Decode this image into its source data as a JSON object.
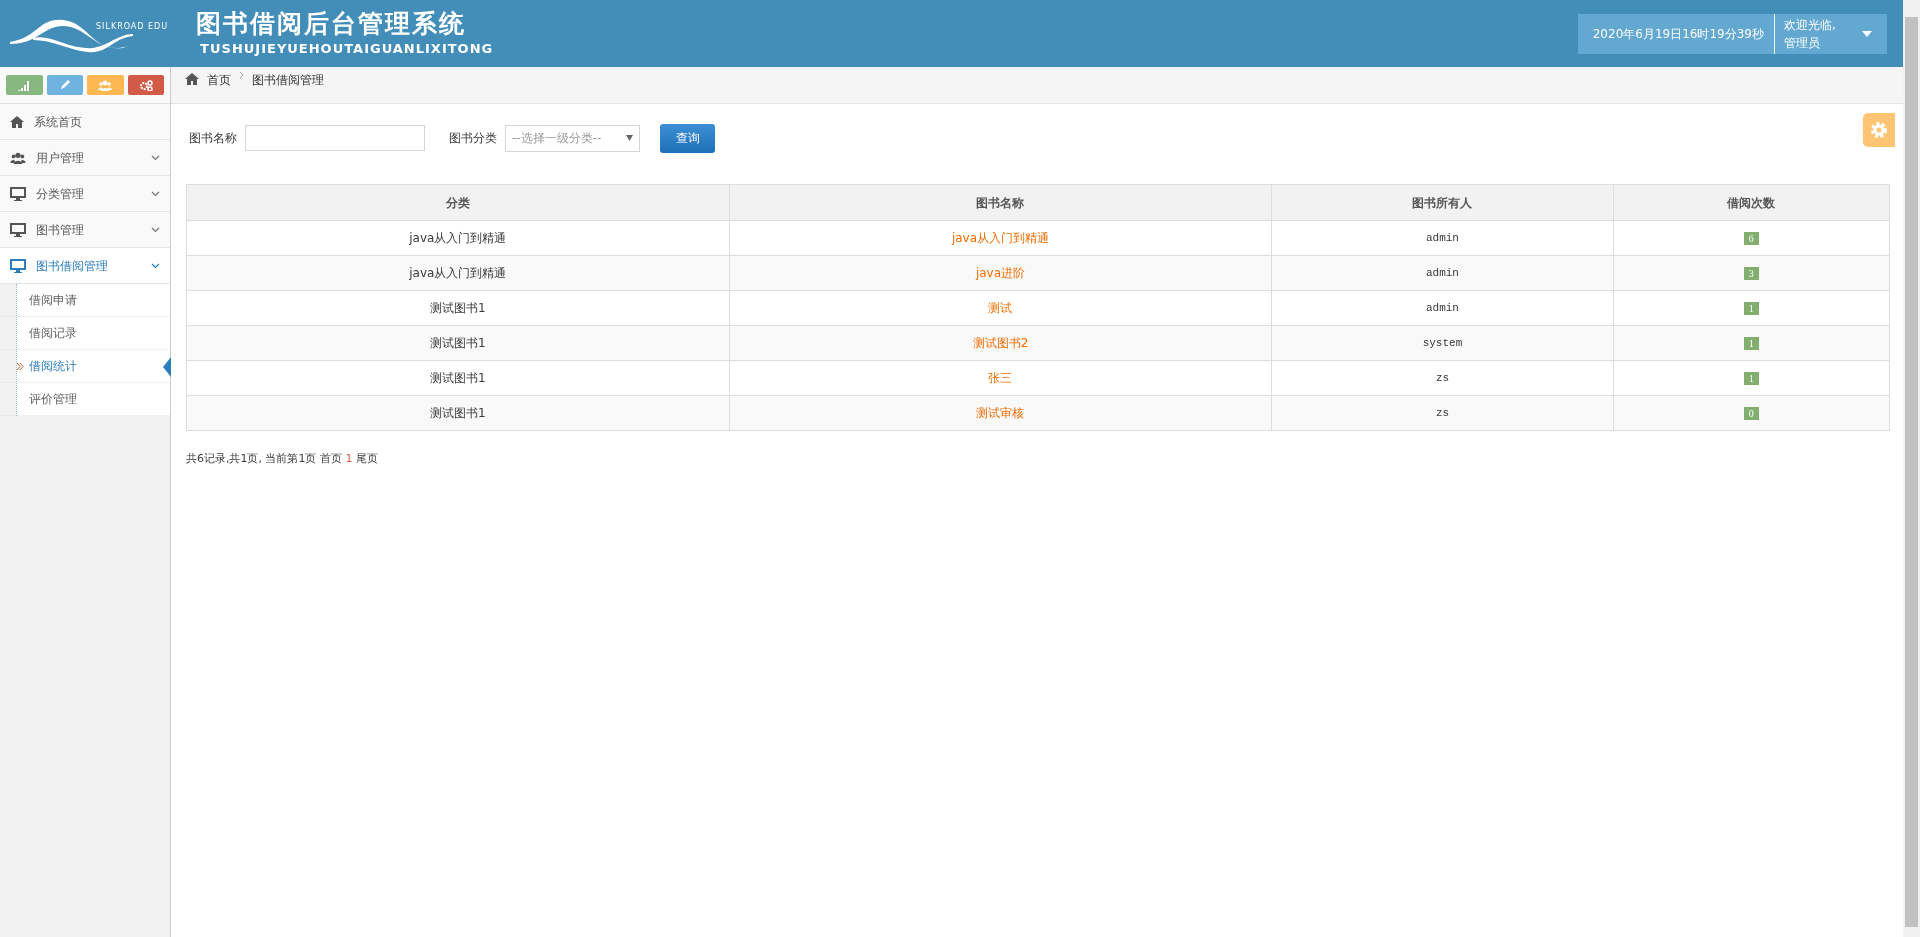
{
  "header": {
    "logo_text": "SILKROAD EDU",
    "title": "图书借阅后台管理系统",
    "subtitle": "TUSHUJIEYUEHOUTAIGUANLIXITONG",
    "datetime": "2020年6月19日16时19分39秒",
    "welcome": "欢迎光临,管理员"
  },
  "sidebar": {
    "shortcuts": [
      {
        "kind": "signal",
        "color": "#87b87f"
      },
      {
        "kind": "pencil",
        "color": "#6fb3e0"
      },
      {
        "kind": "users",
        "color": "#ffb752"
      },
      {
        "kind": "cogs",
        "color": "#d15b47"
      }
    ],
    "items": [
      {
        "label": "系统首页",
        "kind": "home",
        "selected": false
      },
      {
        "label": "用户管理",
        "kind": "users",
        "selected": false,
        "has_submenu": true
      },
      {
        "label": "分类管理",
        "kind": "monitor",
        "selected": false,
        "has_submenu": true
      },
      {
        "label": "图书管理",
        "kind": "monitor",
        "selected": false,
        "has_submenu": true
      },
      {
        "label": "图书借阅管理",
        "kind": "monitor",
        "selected": true,
        "has_submenu": true,
        "expanded": true,
        "children": [
          {
            "label": "借阅申请",
            "selected": false
          },
          {
            "label": "借阅记录",
            "selected": false
          },
          {
            "label": "借阅统计",
            "selected": true
          },
          {
            "label": "评价管理",
            "selected": false
          }
        ]
      }
    ]
  },
  "breadcrumb": [
    "首页",
    "图书借阅管理"
  ],
  "search": {
    "name_label": "图书名称",
    "category_label": "图书分类",
    "category_placeholder": "--选择一级分类--",
    "button": "查询"
  },
  "table": {
    "columns": [
      "分类",
      "图书名称",
      "图书所有人",
      "借阅次数"
    ],
    "rows": [
      [
        "java从入门到精通",
        "java从入门到精通",
        "admin",
        "6"
      ],
      [
        "java从入门到精通",
        "java进阶",
        "admin",
        "3"
      ],
      [
        "测试图书1",
        "测试",
        "admin",
        "1"
      ],
      [
        "测试图书1",
        "测试图书2",
        "system",
        "1"
      ],
      [
        "测试图书1",
        "张三",
        "zs",
        "1"
      ],
      [
        "测试图书1",
        "测试审核",
        "zs",
        "0"
      ]
    ]
  },
  "pagination": {
    "summary": "共6记录,共1页, 当前第1页 首页",
    "current": "1",
    "last": "尾页"
  }
}
